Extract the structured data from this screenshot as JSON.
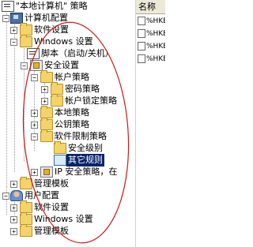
{
  "tree": {
    "root": "\"本地计算机\" 策略",
    "computer_config": "计算机配置",
    "software_settings": "软件设置",
    "windows_settings": "Windows 设置",
    "scripts": "脚本（启动/关机）",
    "security_settings": "安全设置",
    "account_policies": "帐户策略",
    "password_policy": "密码策略",
    "account_lockout": "帐户锁定策略",
    "local_policies": "本地策略",
    "public_key": "公钥策略",
    "software_restriction": "软件限制策略",
    "security_levels": "安全级别",
    "other_rules": "其它规则",
    "ip_security": "IP 安全策略，在",
    "admin_templates": "管理模板",
    "user_config": "用户配置",
    "user_software": "软件设置",
    "user_windows": "Windows 设置",
    "user_admin": "管理模板"
  },
  "right_pane": {
    "header": "名称",
    "items": [
      "%HKEY",
      "%HKEY",
      "%HKEY",
      "%HKEY"
    ]
  }
}
